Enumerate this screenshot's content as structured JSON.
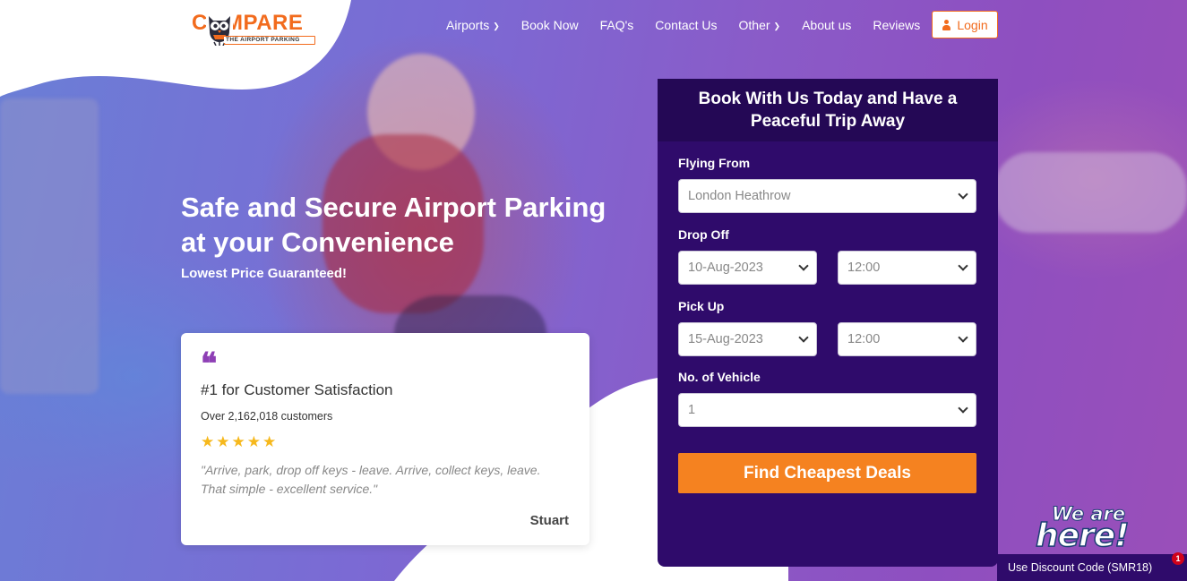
{
  "brand": {
    "logo_word": "COMPARE",
    "logo_tagline": "THE AIRPORT PARKING",
    "accent_color": "#f26b1d",
    "purple_color": "#2f0b6b"
  },
  "nav": {
    "items": [
      {
        "label": "Airports",
        "has_dropdown": true
      },
      {
        "label": "Book Now",
        "has_dropdown": false
      },
      {
        "label": "FAQ's",
        "has_dropdown": false
      },
      {
        "label": "Contact Us",
        "has_dropdown": false
      },
      {
        "label": "Other",
        "has_dropdown": true
      },
      {
        "label": "About us",
        "has_dropdown": false
      },
      {
        "label": "Reviews",
        "has_dropdown": false
      }
    ],
    "login_label": "Login"
  },
  "hero": {
    "title": "Safe and Secure Airport Parking at your Convenience",
    "subtitle": "Lowest Price Guaranteed!"
  },
  "testimonial": {
    "quote_mark": "❝",
    "title": "#1 for Customer Satisfaction",
    "count": "Over 2,162,018 customers",
    "rating": 5,
    "text": "\"Arrive, park, drop off keys - leave. Arrive, collect keys, leave. That simple - excellent service.\"",
    "author": "Stuart"
  },
  "booking": {
    "heading": "Book With Us Today and Have a Peaceful Trip Away",
    "flying_from_label": "Flying From",
    "flying_from_value": "London Heathrow",
    "drop_off_label": "Drop Off",
    "drop_off_date": "10-Aug-2023",
    "drop_off_time": "12:00",
    "pick_up_label": "Pick Up",
    "pick_up_date": "15-Aug-2023",
    "pick_up_time": "12:00",
    "vehicles_label": "No. of Vehicle",
    "vehicles_value": "1",
    "submit_label": "Find Cheapest Deals"
  },
  "chat": {
    "line1": "We are",
    "line2": "here!",
    "discount_text": "Use Discount Code (SMR18)",
    "badge_count": "1"
  }
}
